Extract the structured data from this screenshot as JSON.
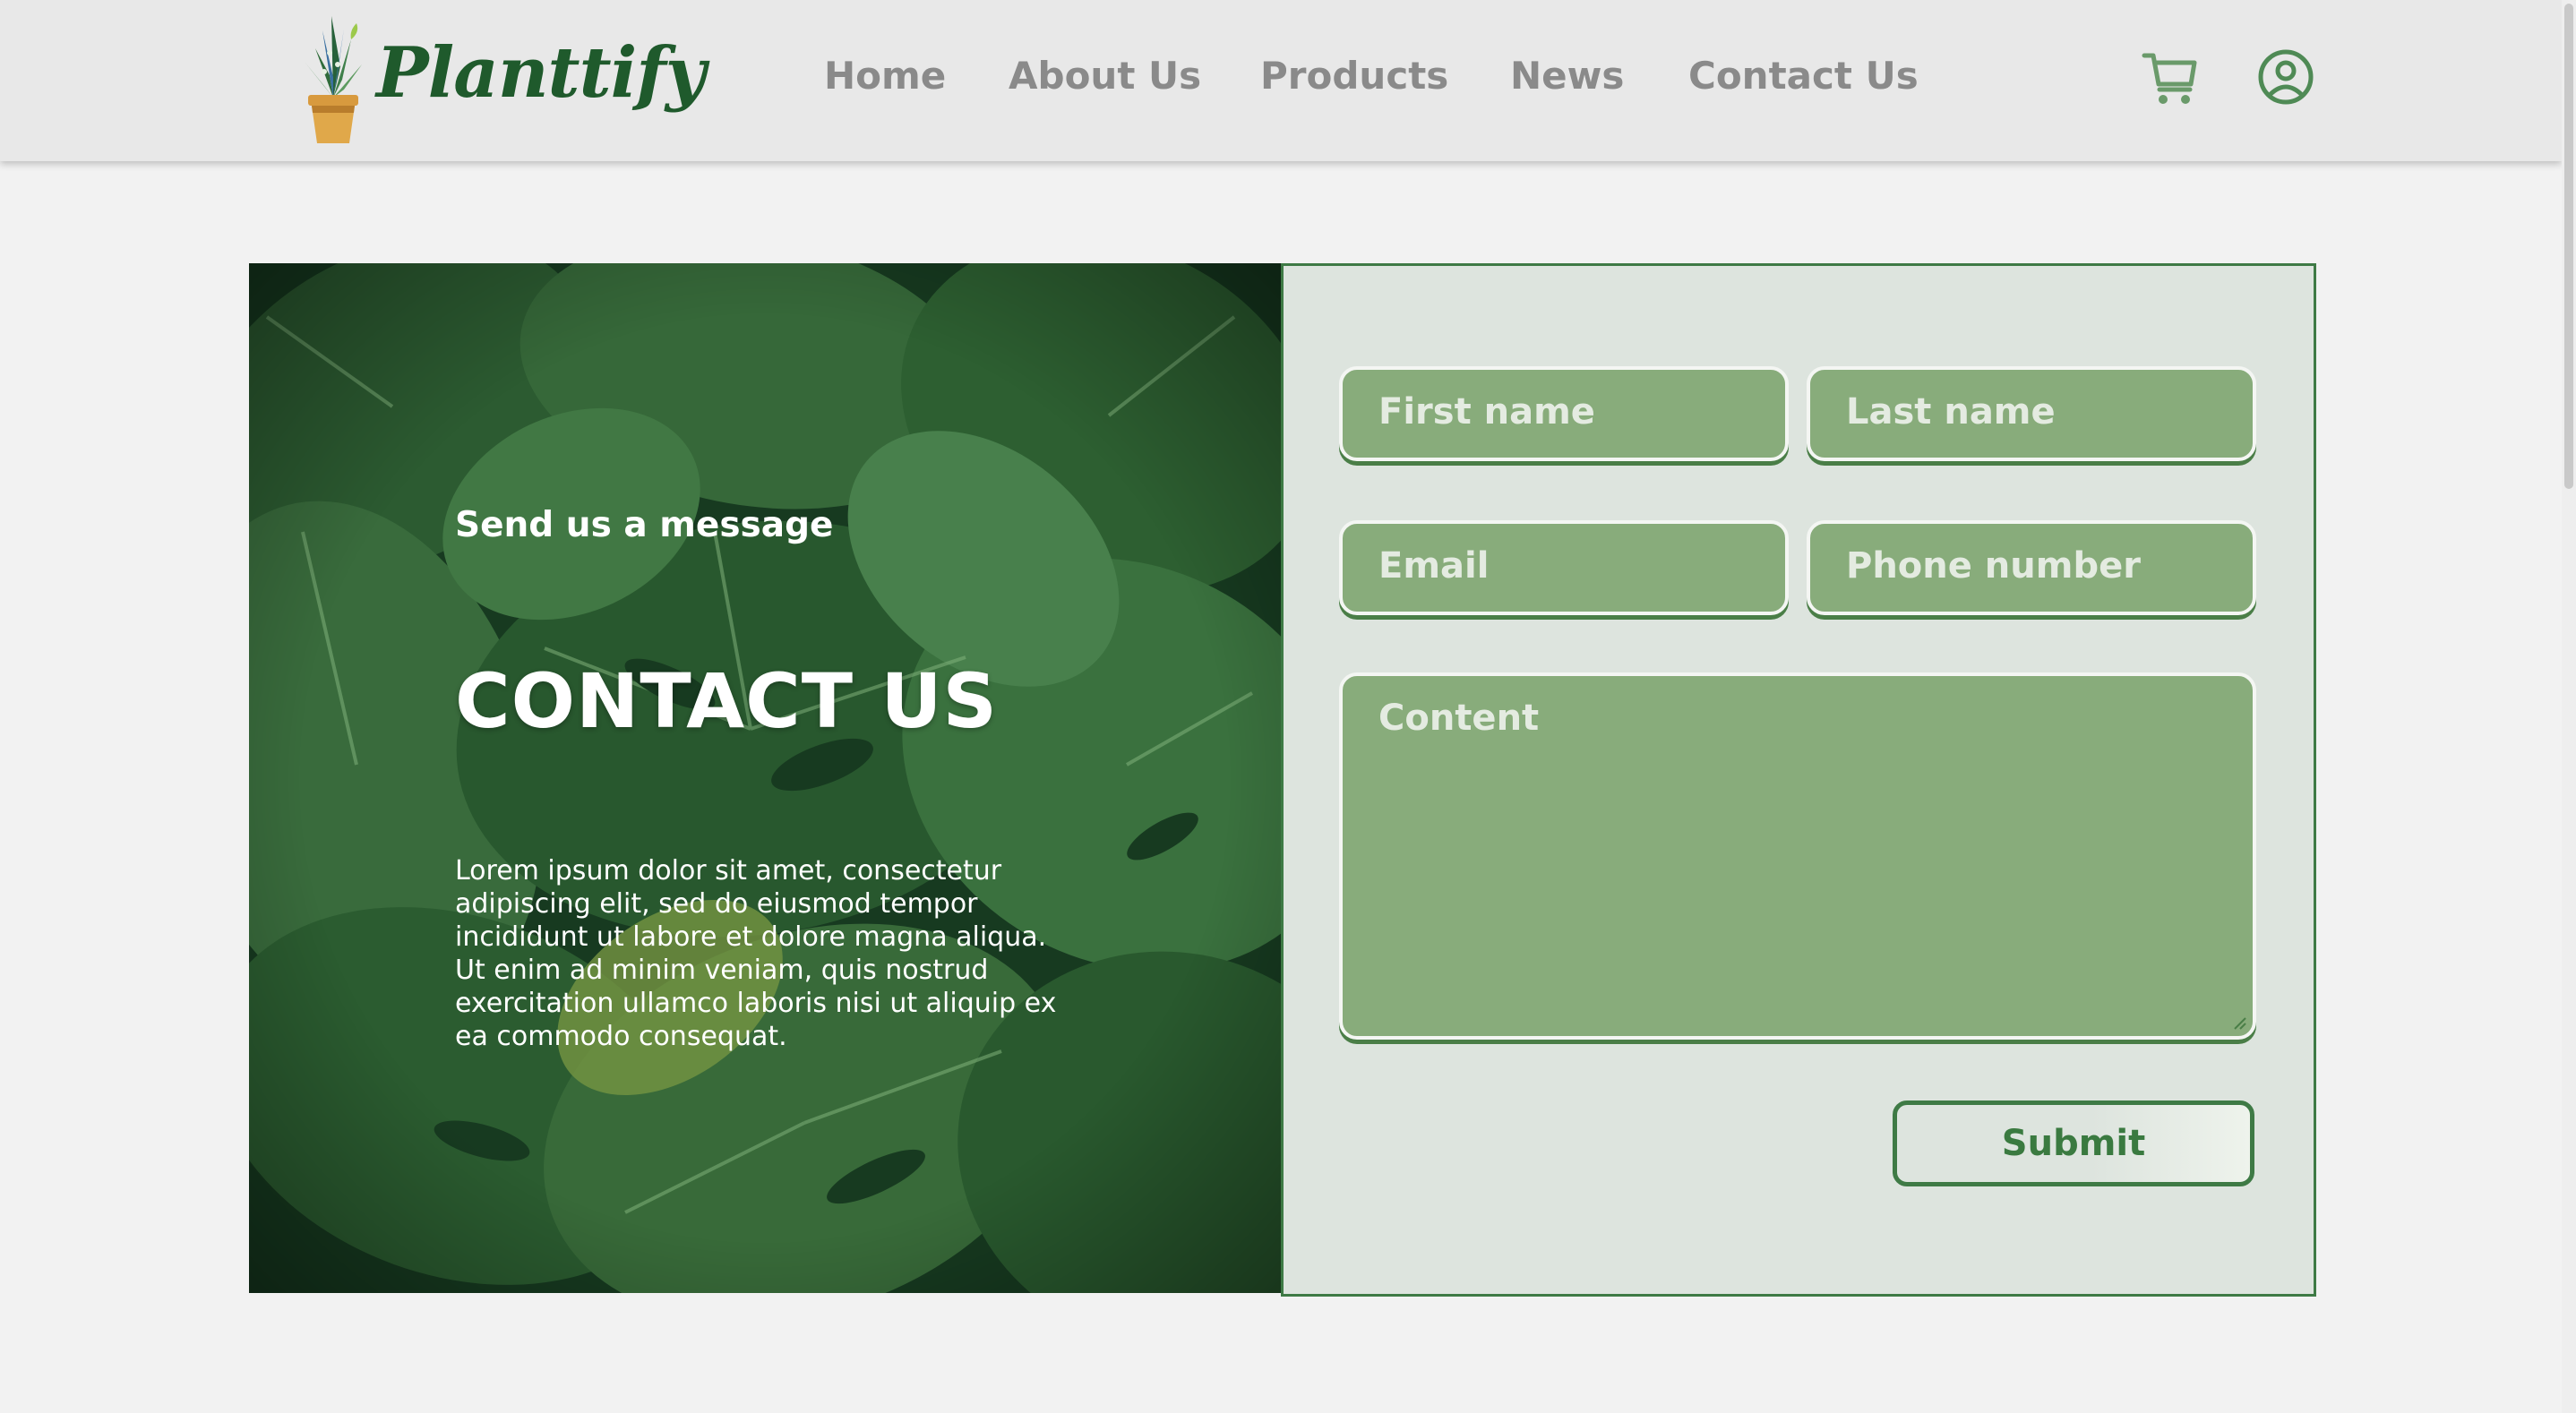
{
  "brand": {
    "name": "Planttify"
  },
  "nav": {
    "items": [
      {
        "label": "Home"
      },
      {
        "label": "About Us"
      },
      {
        "label": "Products"
      },
      {
        "label": "News"
      },
      {
        "label": "Contact Us"
      }
    ]
  },
  "header_icons": {
    "cart": "cart-icon",
    "account": "user-circle-icon"
  },
  "hero": {
    "subtitle": "Send us a message",
    "title": "CONTACT US",
    "body": "Lorem ipsum dolor sit amet, consectetur adipiscing elit, sed do eiusmod tempor incididunt ut labore et dolore magna aliqua. Ut enim ad minim veniam, quis nostrud exercitation ullamco laboris nisi ut aliquip ex ea commodo consequat."
  },
  "form": {
    "first_name_placeholder": "First name",
    "last_name_placeholder": "Last name",
    "email_placeholder": "Email",
    "phone_placeholder": "Phone number",
    "content_placeholder": "Content",
    "submit_label": "Submit"
  },
  "colors": {
    "brand_green": "#1f5a2c",
    "field_green": "#88ac7b",
    "border_green": "#3e7a45",
    "form_background": "#dde4de",
    "nav_text": "#8a8a8a"
  }
}
